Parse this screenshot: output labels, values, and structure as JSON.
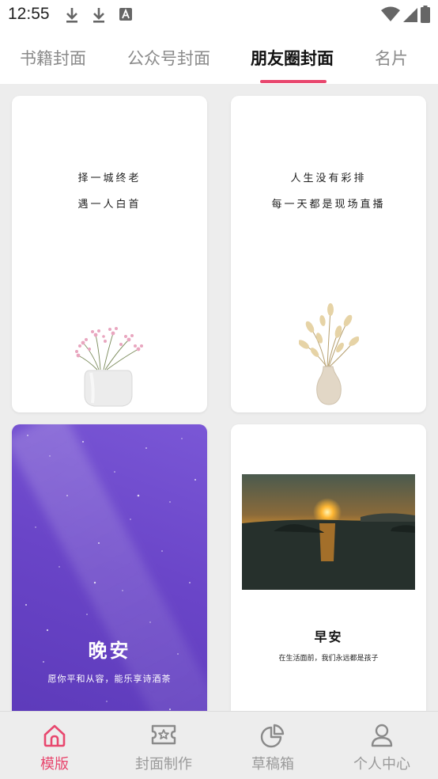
{
  "status_bar": {
    "time": "12:55"
  },
  "tabs": [
    {
      "label": "书籍封面"
    },
    {
      "label": "公众号封面"
    },
    {
      "label": "朋友圈封面"
    },
    {
      "label": "名片"
    }
  ],
  "active_tab": "朋友圈封面",
  "cards": {
    "card1": {
      "line1": "择一城终老",
      "line2": "遇一人白首"
    },
    "card2": {
      "line1": "人生没有彩排",
      "line2": "每一天都是现场直播"
    },
    "card3": {
      "title": "晚安",
      "subtitle": "愿你平和从容，能乐享诗酒茶"
    },
    "card4": {
      "title": "早安",
      "subtitle": "在生活面前，我们永远都是孩子"
    }
  },
  "bottom_nav": [
    {
      "label": "模版",
      "icon": "home-icon"
    },
    {
      "label": "封面制作",
      "icon": "star-ticket-icon"
    },
    {
      "label": "草稿箱",
      "icon": "pie-chart-icon"
    },
    {
      "label": "个人中心",
      "icon": "user-icon"
    }
  ],
  "colors": {
    "accent": "#e8476e",
    "night_purple": "#6a45c8"
  }
}
